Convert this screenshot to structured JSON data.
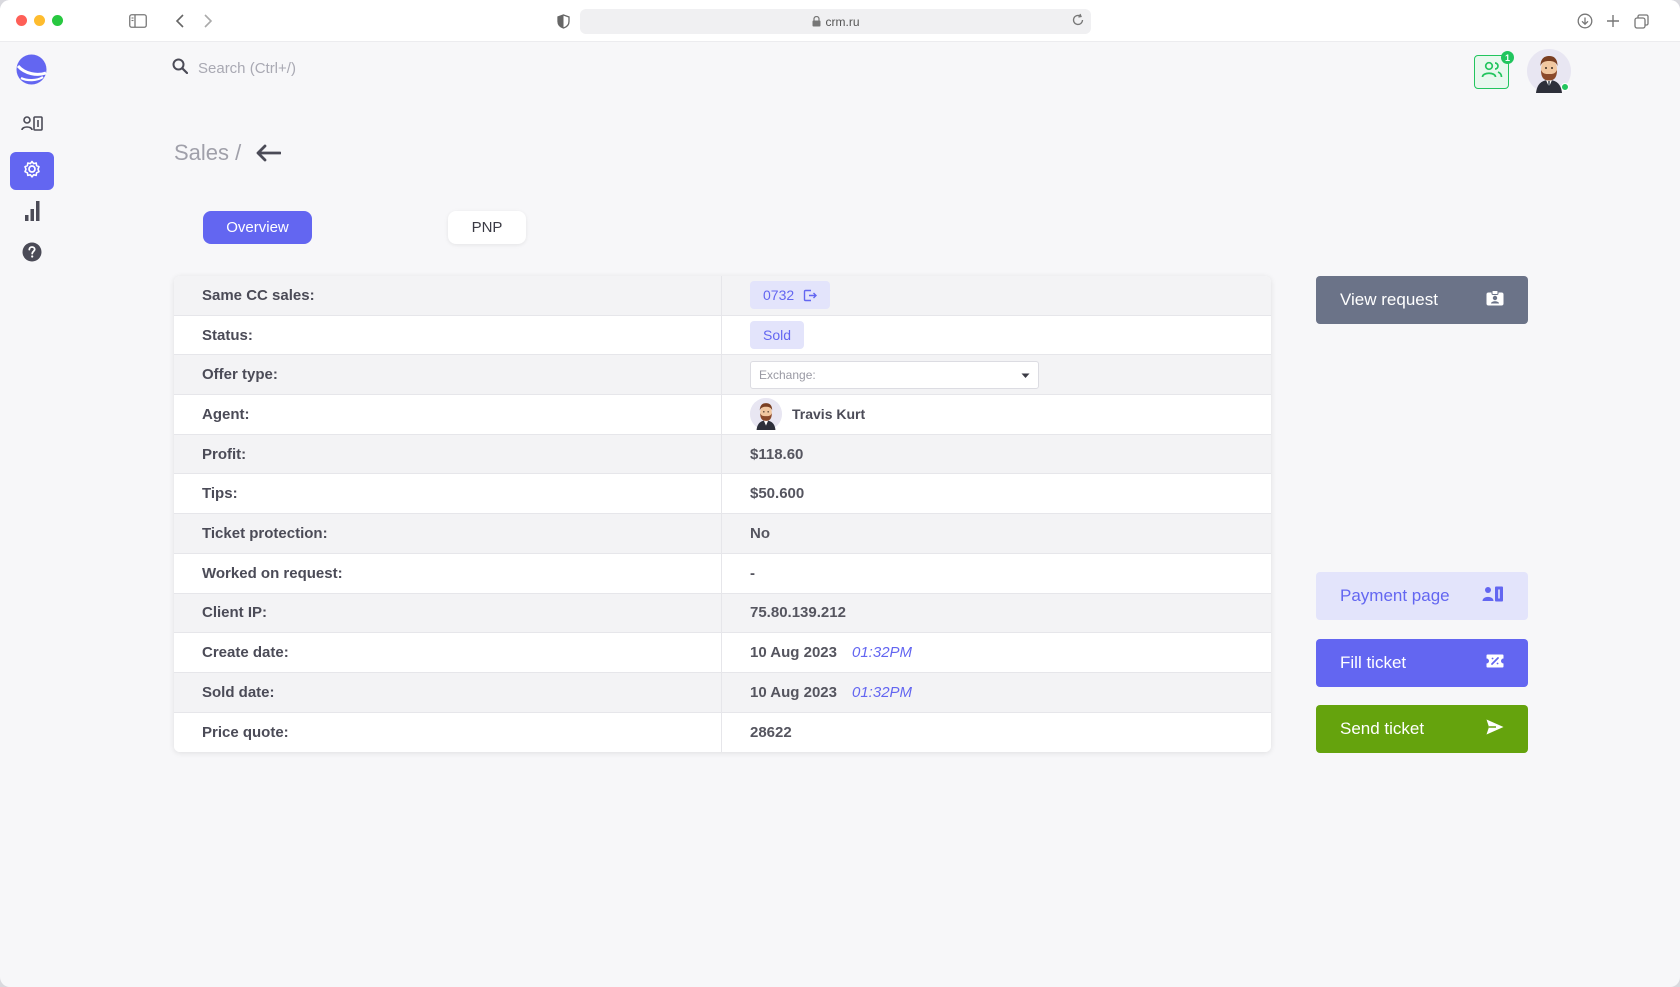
{
  "browser": {
    "url": "crm.ru"
  },
  "topbar": {
    "search_placeholder": "Search (Ctrl+/)",
    "contacts_badge": "1"
  },
  "breadcrumb": {
    "section": "Sales /"
  },
  "tabs": [
    {
      "label": "Overview",
      "active": true
    },
    {
      "label": "PNP",
      "active": false
    }
  ],
  "details": {
    "same_cc_label": "Same CC sales:",
    "same_cc_value": "0732",
    "status_label": "Status:",
    "status_value": "Sold",
    "offer_type_label": "Offer type:",
    "offer_type_placeholder": "Exchange:",
    "agent_label": "Agent:",
    "agent_name": "Travis Kurt",
    "profit_label": "Profit:",
    "profit_value": "$118.60",
    "tips_label": "Tips:",
    "tips_value": "$50.600",
    "ticket_protection_label": "Ticket protection:",
    "ticket_protection_value": "No",
    "worked_on_request_label": "Worked on request:",
    "worked_on_request_value": "-",
    "client_ip_label": "Client IP:",
    "client_ip_value": "75.80.139.212",
    "create_date_label": "Create date:",
    "create_date_value": "10 Aug 2023",
    "create_time_value": "01:32PM",
    "sold_date_label": "Sold date:",
    "sold_date_value": "10 Aug 2023",
    "sold_time_value": "01:32PM",
    "price_quote_label": "Price quote:",
    "price_quote_value": "28622"
  },
  "actions": {
    "view_request": "View request",
    "payment_page": "Payment page",
    "fill_ticket": "Fill ticket",
    "send_ticket": "Send ticket"
  },
  "colors": {
    "accent": "#6366f1",
    "accent_light": "#e3e4fb",
    "view_button": "#6b7388",
    "send_button": "#65a30d",
    "online": "#22c55e"
  }
}
